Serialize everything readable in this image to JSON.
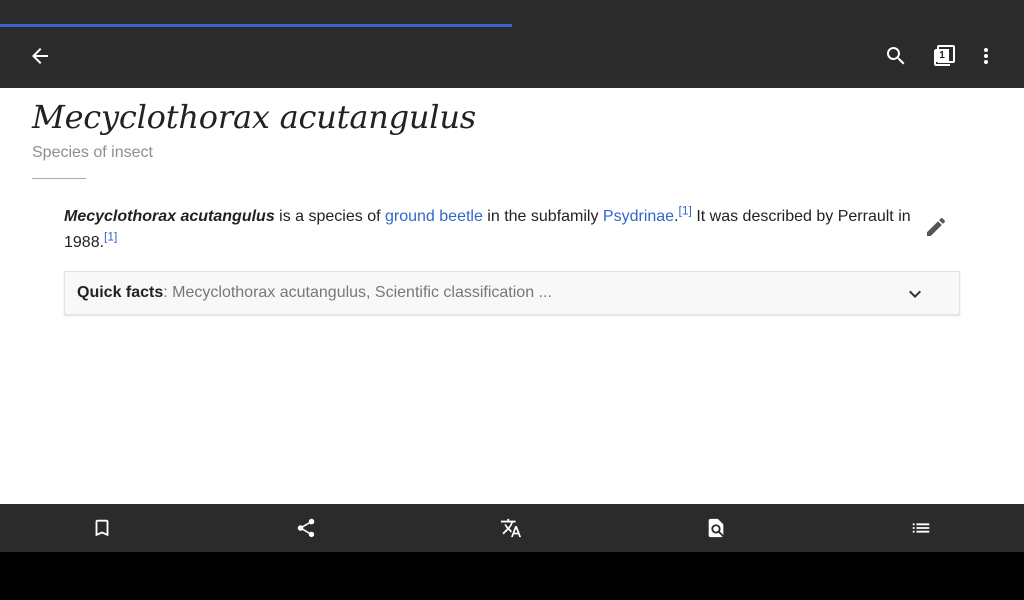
{
  "load_progress": 0.5,
  "toolbar": {
    "back_icon": "arrow-back-icon",
    "search_icon": "search-icon",
    "tabs_icon": "tabs-icon",
    "tab_count": "1",
    "more_icon": "more-vert-icon"
  },
  "article": {
    "title": "Mecyclothorax acutangulus",
    "description": "Species of insect",
    "paragraph": {
      "bold_name": "Mecyclothorax acutangulus",
      "text1": " is a species of ",
      "link1": "ground beetle",
      "text2": " in the subfamily ",
      "link2": "Psydrinae",
      "text3": ".",
      "ref1": "[1]",
      "text4": " It was described by Perrault in 1988.",
      "ref2": "[1]"
    },
    "edit_icon": "pencil-icon",
    "quick_facts": {
      "label": "Quick facts",
      "summary": ": Mecyclothorax acutangulus, Scientific classification ...",
      "expand_icon": "chevron-down-icon"
    }
  },
  "bottom_bar": {
    "items": [
      "bookmark-icon",
      "share-icon",
      "translate-icon",
      "find-in-page-icon",
      "contents-icon"
    ]
  }
}
